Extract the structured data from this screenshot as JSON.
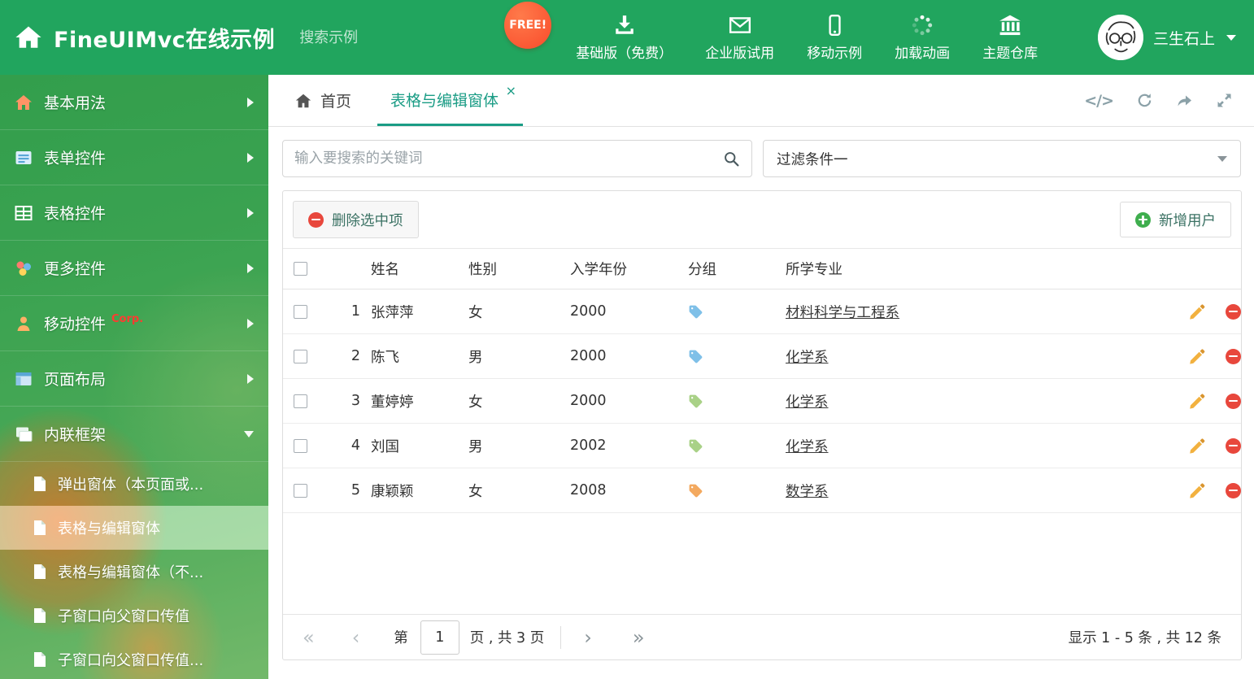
{
  "colors": {
    "header_green": "#21a55e",
    "accent_teal": "#1a9c85",
    "free_badge": "#f94b2b",
    "tag_blue": "#7fc0e8",
    "tag_green": "#a9d187",
    "tag_orange": "#f3a95f"
  },
  "header": {
    "title": "FineUIMvc在线示例",
    "search_placeholder": "搜索示例",
    "free_badge": "FREE!",
    "nav": [
      {
        "label": "基础版（免费）",
        "icon": "download-icon"
      },
      {
        "label": "企业版试用",
        "icon": "envelope-icon"
      },
      {
        "label": "移动示例",
        "icon": "mobile-icon"
      },
      {
        "label": "加载动画",
        "icon": "spinner-icon"
      },
      {
        "label": "主题仓库",
        "icon": "bank-icon"
      }
    ],
    "user_name": "三生石上"
  },
  "sidebar": {
    "items": [
      {
        "label": "基本用法",
        "icon": "home-icon"
      },
      {
        "label": "表单控件",
        "icon": "form-icon"
      },
      {
        "label": "表格控件",
        "icon": "table-icon"
      },
      {
        "label": "更多控件",
        "icon": "more-controls-icon"
      },
      {
        "label": "移动控件",
        "badge": "Corp.",
        "icon": "mobile-controls-icon"
      },
      {
        "label": "页面布局",
        "icon": "layout-icon"
      },
      {
        "label": "内联框架",
        "icon": "frame-icon"
      }
    ],
    "subitems": [
      {
        "label": "弹出窗体（本页面或..."
      },
      {
        "label": "表格与编辑窗体",
        "active": true
      },
      {
        "label": "表格与编辑窗体（不..."
      },
      {
        "label": "子窗口向父窗口传值"
      },
      {
        "label": "子窗口向父窗口传值..."
      }
    ]
  },
  "tabbar": {
    "home_label": "首页",
    "active_label": "表格与编辑窗体",
    "close_glyph": "×",
    "code_glyph": "</>"
  },
  "filters": {
    "search_placeholder": "输入要搜索的关键词",
    "filter_value": "过滤条件一"
  },
  "toolbar": {
    "delete_label": "删除选中项",
    "add_label": "新增用户"
  },
  "table": {
    "headers": {
      "name": "姓名",
      "gender": "性别",
      "year": "入学年份",
      "group": "分组",
      "major": "所学专业"
    },
    "rows": [
      {
        "num": "1",
        "name": "张萍萍",
        "gender": "女",
        "year": "2000",
        "tag": "blue",
        "major": "材料科学与工程系"
      },
      {
        "num": "2",
        "name": "陈飞",
        "gender": "男",
        "year": "2000",
        "tag": "blue",
        "major": "化学系"
      },
      {
        "num": "3",
        "name": "董婷婷",
        "gender": "女",
        "year": "2000",
        "tag": "green",
        "major": "化学系"
      },
      {
        "num": "4",
        "name": "刘国",
        "gender": "男",
        "year": "2002",
        "tag": "green",
        "major": "化学系"
      },
      {
        "num": "5",
        "name": "康颖颖",
        "gender": "女",
        "year": "2008",
        "tag": "orange",
        "major": "数学系"
      }
    ]
  },
  "pagination": {
    "icons": {
      "first": "«",
      "prev": "‹",
      "next": "›",
      "last": "»"
    },
    "prefix": "第",
    "page_value": "1",
    "suffix": "页 , 共 3 页",
    "summary": "显示 1 - 5 条 , 共 12 条"
  }
}
